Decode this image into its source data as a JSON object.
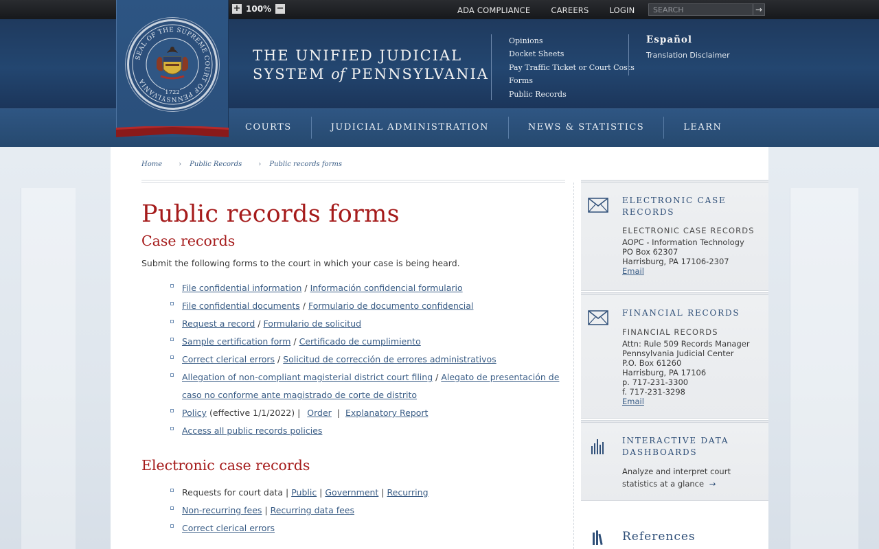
{
  "topbar": {
    "zoom_in": "+",
    "zoom_value": "100%",
    "zoom_out": "−",
    "links": [
      "ADA COMPLIANCE",
      "CAREERS",
      "LOGIN"
    ],
    "search_placeholder": "SEARCH",
    "search_go": "→"
  },
  "header": {
    "seal_text": "SEAL OF THE SUPREME COURT OF PENNSYLVANIA",
    "seal_year": "1722",
    "title_line1": "THE UNIFIED JUDICIAL",
    "title_line2_a": "SYSTEM ",
    "title_line2_of": "of",
    "title_line2_b": " PENNSYLVANIA",
    "quick_links": [
      "Opinions",
      "Docket Sheets",
      "Pay Traffic Ticket or Court Costs",
      "Forms",
      "Public Records"
    ],
    "language": "Español",
    "translation_disclaimer": "Translation Disclaimer"
  },
  "nav": [
    "COURTS",
    "JUDICIAL ADMINISTRATION",
    "NEWS & STATISTICS",
    "LEARN"
  ],
  "breadcrumb": [
    "Home",
    "Public Records",
    "Public records forms"
  ],
  "breadcrumb_sep": "›",
  "main": {
    "title": "Public records forms",
    "case_records": {
      "heading": "Case records",
      "intro": "Submit the following forms to the court in which your case is being heard.",
      "items": [
        {
          "a": "File confidential information",
          "sep": " / ",
          "b": "Información confidencial formulario"
        },
        {
          "a": "File confidential documents",
          "sep": " / ",
          "b": "Formulario de documento confidencial"
        },
        {
          "a": "Request a record",
          "sep": " / ",
          "b": "Formulario de solicitud"
        },
        {
          "a": "Sample certification form",
          "sep": " / ",
          "b": "Certificado de cumplimiento"
        },
        {
          "a": "Correct clerical errors",
          "sep": " / ",
          "b": "Solicitud de corrección de errores administrativos"
        },
        {
          "a": "Allegation of non-compliant magisterial district court filing",
          "sep": " / ",
          "b": "Alegato de presentación de caso no conforme ante magistrado de corte de distrito"
        }
      ],
      "policy": {
        "link": "Policy",
        "text": " (effective 1/1/2022) | ",
        "order": "Order",
        "sep": " | ",
        "report": "Explanatory Report"
      },
      "all_policies": "Access all public records policies"
    },
    "electronic": {
      "heading": "Electronic case records",
      "requests_text": "Requests for court data | ",
      "public": "Public",
      "sep": " | ",
      "government": "Government",
      "recurring": "Recurring",
      "nonrecurring": "Non-recurring fees",
      "recurring_fees": "Recurring data fees",
      "correct": "Correct clerical errors"
    }
  },
  "sidebar": {
    "electronic": {
      "heading": "ELECTRONIC CASE RECORDS",
      "sub": "ELECTRONIC CASE RECORDS",
      "lines": [
        "AOPC - Information Technology",
        "PO Box 62307",
        "Harrisburg, PA 17106-2307"
      ],
      "email": "Email"
    },
    "financial": {
      "heading": "FINANCIAL RECORDS",
      "sub": "FINANCIAL RECORDS",
      "lines": [
        "Attn: Rule 509 Records Manager",
        "Pennsylvania Judicial Center",
        "P.O. Box 61260",
        "Harrisburg, PA 17106",
        "p. 717-231-3300",
        "f. 717-231-3298"
      ],
      "email": "Email"
    },
    "dashboards": {
      "heading": "INTERACTIVE DATA DASHBOARDS",
      "text": "Analyze and interpret court statistics at a glance",
      "arrow": "→"
    },
    "references": "References"
  }
}
